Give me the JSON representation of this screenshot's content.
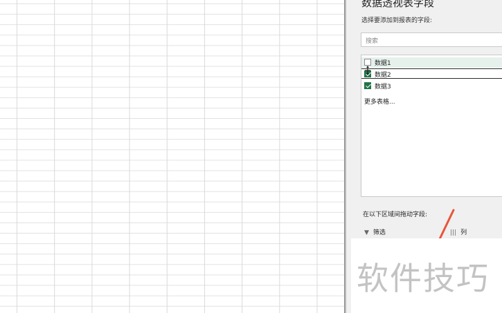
{
  "pane": {
    "title": "数据透视表字段",
    "subtitle": "选择要添加到报表的字段:",
    "search_placeholder": "搜索",
    "fields": [
      {
        "label": "数据1",
        "checked": false
      },
      {
        "label": "数据2",
        "checked": true
      },
      {
        "label": "数据3",
        "checked": true
      }
    ],
    "more_tables": "更多表格...",
    "drag_hint": "在以下区域间拖动字段:",
    "areas": {
      "filter": "筛选",
      "columns": "列"
    }
  },
  "watermark": "软件技巧",
  "colors": {
    "accent_green": "#217346",
    "grid_line": "#d9d9d9",
    "pane_bg": "#f0f0f0",
    "pen_red": "#e8553a"
  },
  "icons": {
    "filter": "filter-icon",
    "columns": "columns-icon",
    "cursor": "move-cursor-icon"
  }
}
